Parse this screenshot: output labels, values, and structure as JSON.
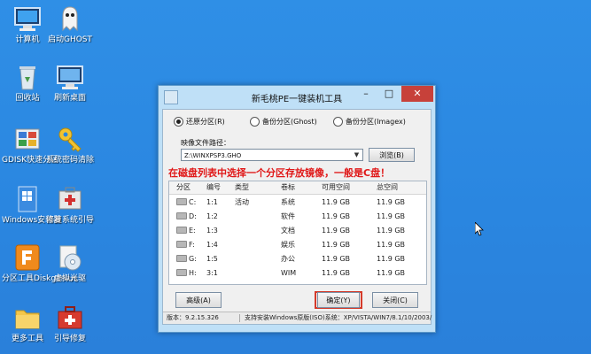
{
  "desktop": {
    "icons": [
      {
        "label": "计算机",
        "icon": "computer-icon"
      },
      {
        "label": "启动GHOST",
        "icon": "ghost-icon"
      },
      {
        "label": "回收站",
        "icon": "recycle-bin-icon"
      },
      {
        "label": "刷新桌面",
        "icon": "refresh-desktop-icon"
      },
      {
        "label": "GDISK快速分区",
        "icon": "gdisk-icon"
      },
      {
        "label": "系统密码清除",
        "icon": "password-key-icon"
      },
      {
        "label": "Windows安装器",
        "icon": "windows-installer-icon"
      },
      {
        "label": "修复系统引导",
        "icon": "boot-repair-icon"
      },
      {
        "label": "分区工具Diskgenius",
        "icon": "diskgenius-icon"
      },
      {
        "label": "虚拟光驱",
        "icon": "virtual-drive-icon"
      },
      {
        "label": "更多工具",
        "icon": "folder-icon"
      },
      {
        "label": "引导修复",
        "icon": "toolbox-icon"
      }
    ]
  },
  "window": {
    "title": "新毛桃PE一键装机工具",
    "minimize": "–",
    "maximize": "□",
    "close": "✕",
    "radios": [
      {
        "label": "还原分区(R)",
        "checked": true
      },
      {
        "label": "备份分区(Ghost)",
        "checked": false
      },
      {
        "label": "备份分区(Imagex)",
        "checked": false
      }
    ],
    "image_path_label": "映像文件路径：",
    "image_path_value": "Z:\\WINXPSP3.GHO",
    "browse_button": "浏览(B)",
    "annotation": "在磁盘列表中选择一个分区存放镜像，一般是C盘！",
    "table": {
      "headers": [
        "分区",
        "编号",
        "类型",
        "卷标",
        "可用空间",
        "总空间"
      ],
      "rows": [
        [
          "C:",
          "1:1",
          "活动",
          "系统",
          "11.9 GB",
          "11.9 GB"
        ],
        [
          "D:",
          "1:2",
          "",
          "软件",
          "11.9 GB",
          "11.9 GB"
        ],
        [
          "E:",
          "1:3",
          "",
          "文档",
          "11.9 GB",
          "11.9 GB"
        ],
        [
          "F:",
          "1:4",
          "",
          "娱乐",
          "11.9 GB",
          "11.9 GB"
        ],
        [
          "G:",
          "1:5",
          "",
          "办公",
          "11.9 GB",
          "11.9 GB"
        ],
        [
          "H:",
          "3:1",
          "",
          "WIM",
          "11.9 GB",
          "11.9 GB"
        ]
      ]
    },
    "advanced_button": "高级(A)",
    "ok_button": "确定(Y)",
    "close_button": "关闭(C)",
    "status": {
      "version": "版本：9.2.15.326",
      "support": "支持安装Windows原版(ISO)系统：XP/VISTA/WIN7/8.1/10/2003/"
    },
    "accent_red": "#d43a2a"
  }
}
